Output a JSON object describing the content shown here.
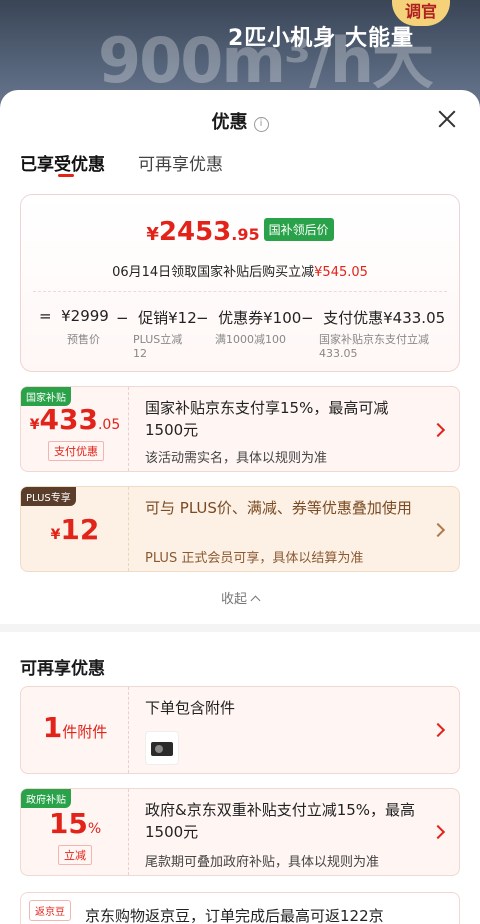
{
  "banner": {
    "big_text": "900m³/h大风量",
    "sub_text": "2匹小机身 大能量",
    "sticker": "调官"
  },
  "sheet": {
    "title": "优惠",
    "info_icon": "i",
    "tabs": [
      "已享受优惠",
      "可再享优惠"
    ]
  },
  "summary": {
    "price_yen": "¥",
    "price_int": "2453",
    "price_dec": ".95",
    "badge": "国补领后价",
    "note_prefix": "06月14日领取国家补贴后购买立减",
    "note_amount": "¥545.05",
    "formula": [
      {
        "op": "=",
        "value": "¥2999",
        "label": "预售价"
      },
      {
        "op": "−",
        "value": "促销¥12",
        "label": "PLUS立减 12"
      },
      {
        "op": "−",
        "value": "优惠券¥100",
        "label": "满1000减100"
      },
      {
        "op": "−",
        "value": "支付优惠¥433.05",
        "label": "国家补贴京东支付立减 433.05"
      }
    ],
    "formula_labels": {
      "plus_line1": "PLUS立减",
      "plus_line2": "12",
      "gov_line1": "国家补贴京东支付立减",
      "gov_line2": "433.05"
    }
  },
  "offers": [
    {
      "tag": "国家补贴",
      "amount_yen": "¥",
      "amount_int": "433",
      "amount_dec": ".05",
      "small_tag": "支付优惠",
      "title": "国家补贴京东支付享15%，最高可减1500元",
      "desc": "该活动需实名，具体以规则为准"
    },
    {
      "tag": "PLUS专享",
      "amount_yen": "¥",
      "amount_int": "12",
      "title": "可与 PLUS价、满减、券等优惠叠加使用",
      "desc": "PLUS 正式会员可享，具体以结算为准"
    }
  ],
  "collapse_label": "收起",
  "more_section": {
    "title": "可再享优惠",
    "items": [
      {
        "amount_int": "1",
        "amount_unit": "件附件",
        "title": "下单包含附件"
      },
      {
        "tag": "政府补贴",
        "amount_int": "15",
        "amount_unit": "%",
        "small_tag": "立减",
        "title": "政府&京东双重补贴支付立减15%，最高1500元",
        "desc": "尾款期可叠加政府补贴，具体以规则为准"
      }
    ],
    "bottom": {
      "tag": "返京豆",
      "text": "京东购物返京豆，订单完成后最高可返122京"
    }
  },
  "colors": {
    "accent_red": "#e2231a",
    "green_badge": "#2aa24a",
    "plus_brown": "#5a3e2b"
  }
}
